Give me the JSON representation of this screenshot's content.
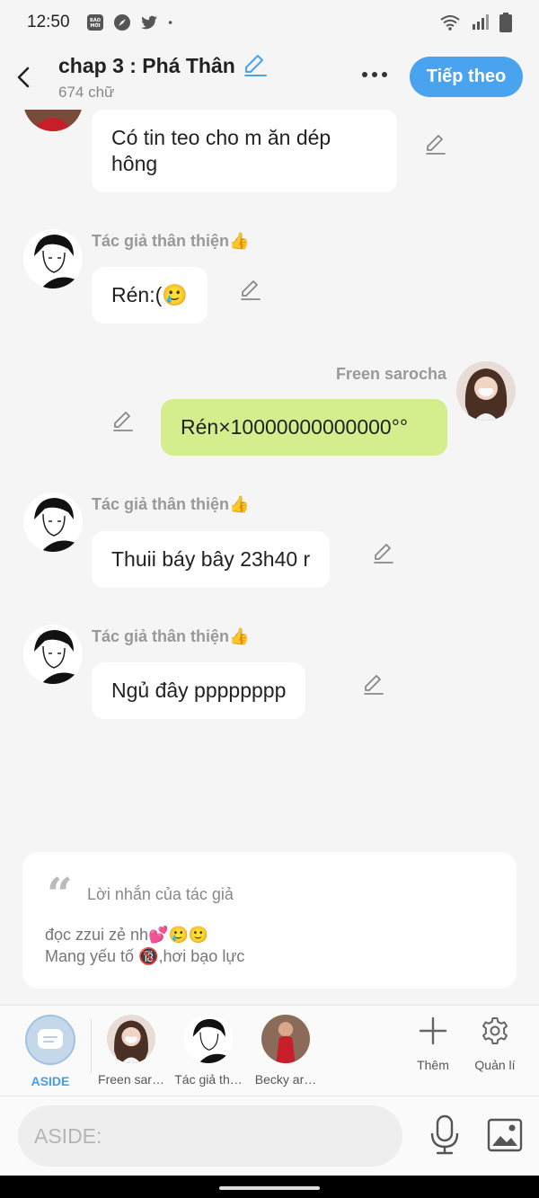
{
  "status_bar": {
    "time": "12:50",
    "left_icons": [
      "bao-moi-icon",
      "compass-icon",
      "twitter-icon",
      "dot-icon"
    ],
    "right_icons": [
      "wifi-icon",
      "signal-icon",
      "battery-icon"
    ],
    "news_icon_text": "BÁO MỚI"
  },
  "header": {
    "title": "chap 3 : Phá Thân",
    "word_count": "674 chữ",
    "next_button": "Tiếp theo",
    "accent_color": "#4aa3ee"
  },
  "messages": [
    {
      "sender": "",
      "text": "Có tin teo cho m ăn dép hông",
      "side": "left"
    },
    {
      "sender": "Tác giả thân thiện👍",
      "text": "Rén:(🥲",
      "side": "left"
    },
    {
      "sender": "Freen sarocha",
      "text": "Rén×10000000000000°°",
      "side": "right",
      "color": "#d4ee8e"
    },
    {
      "sender": "Tác giả thân thiện👍",
      "text": "Thuii báy bây 23h40 r",
      "side": "left"
    },
    {
      "sender": "Tác giả thân thiện👍",
      "text": "Ngủ đây pppppppp",
      "side": "left"
    }
  ],
  "author_note": {
    "title": "Lời nhắn của tác giả",
    "line1": "đọc zzui zẻ nh💕🥲🙂",
    "line2": "Mang yếu tố 🔞,hơi bạo lực"
  },
  "characters": {
    "aside_label": "ASIDE",
    "items": [
      {
        "label": "Freen sar…"
      },
      {
        "label": "Tác giả th…"
      },
      {
        "label": "Becky ar…"
      }
    ],
    "add_label": "Thêm",
    "manage_label": "Quản lí"
  },
  "input": {
    "placeholder": "ASIDE:"
  }
}
